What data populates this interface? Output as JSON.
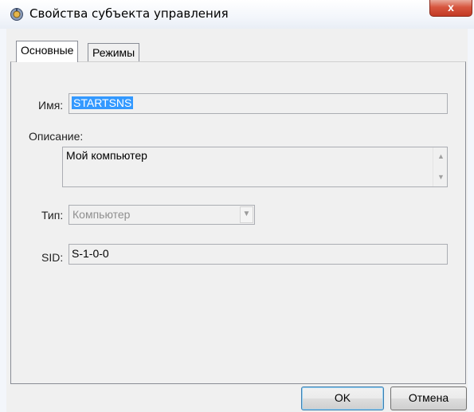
{
  "window": {
    "title": "Свойства субъекта управления",
    "close_label": "x"
  },
  "tabs": [
    {
      "label": "Основные",
      "active": true
    },
    {
      "label": "Режимы",
      "active": false
    }
  ],
  "form": {
    "name_label": "Имя:",
    "name_value": "STARTSNS",
    "description_label": "Описание:",
    "description_value": "Мой компьютер",
    "type_label": "Тип:",
    "type_value": "Компьютер",
    "sid_label": "SID:",
    "sid_value": "S-1-0-0"
  },
  "buttons": {
    "ok": "OK",
    "cancel": "Отмена"
  }
}
